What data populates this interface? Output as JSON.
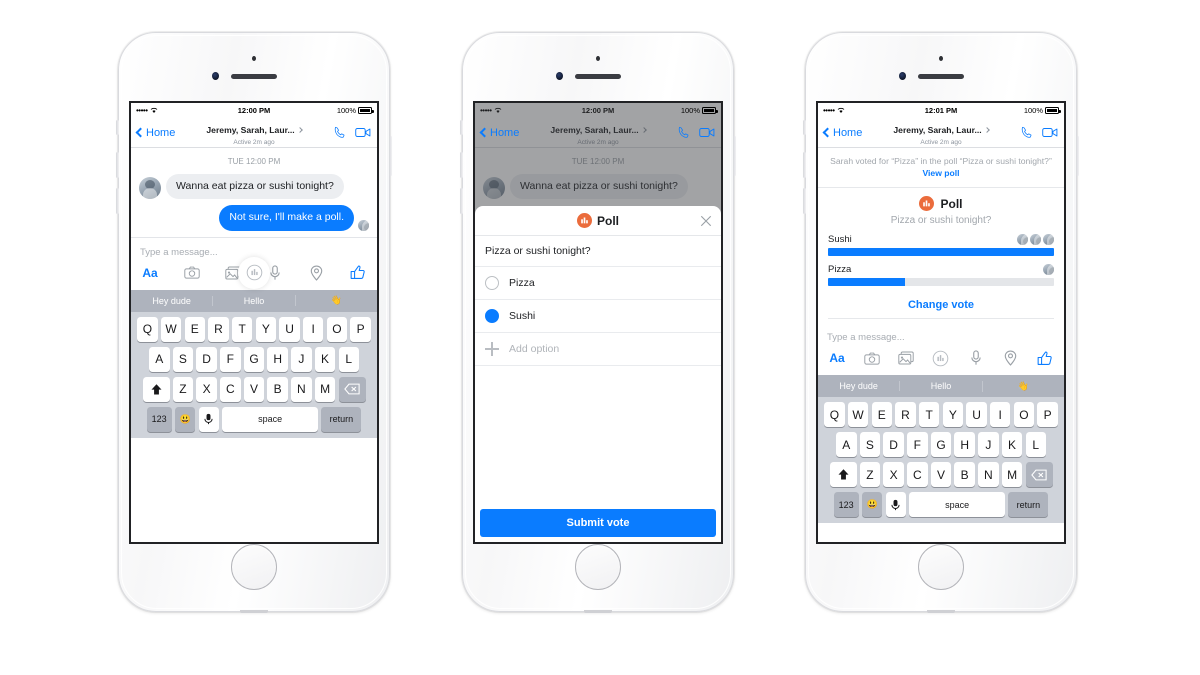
{
  "status_bar": {
    "signal": "•••••",
    "wifi_icon": "wifi-icon",
    "time_1": "12:00 PM",
    "time_2": "12:00 PM",
    "time_3": "12:01 PM",
    "battery": "100%"
  },
  "nav": {
    "back_label": "Home",
    "title": "Jeremy, Sarah, Laur...",
    "subtitle": "Active 2m ago",
    "call_icon": "phone-call-icon",
    "video_icon": "video-call-icon",
    "chevron_icon": "chevron-right-icon"
  },
  "thread": {
    "daystamp": "TUE 12:00 PM",
    "messages": [
      {
        "from": "them",
        "text": "Wanna eat pizza or sushi tonight?"
      },
      {
        "from": "me",
        "text": "Not sure, I'll make a poll."
      }
    ]
  },
  "composer": {
    "placeholder": "Type a message...",
    "icons": [
      "text-format-icon",
      "camera-icon",
      "photos-icon",
      "poll-icon",
      "microphone-icon",
      "location-icon",
      "thumbs-up-icon"
    ]
  },
  "suggestions": [
    "Hey dude",
    "Hello",
    "👋"
  ],
  "keyboard": {
    "row1": [
      "Q",
      "W",
      "E",
      "R",
      "T",
      "Y",
      "U",
      "I",
      "O",
      "P"
    ],
    "row2": [
      "A",
      "S",
      "D",
      "F",
      "G",
      "H",
      "J",
      "K",
      "L"
    ],
    "row3": [
      "Z",
      "X",
      "C",
      "V",
      "B",
      "N",
      "M"
    ],
    "shift": "⬆",
    "backspace": "⌫",
    "numbers": "123",
    "emoji": "😃",
    "dictate": "🎤",
    "space": "space",
    "return": "return"
  },
  "poll_dialog": {
    "title": "Poll",
    "icon": "poll-icon",
    "close_icon": "close-icon",
    "question": "Pizza or sushi tonight?",
    "options": [
      {
        "label": "Pizza",
        "selected": false
      },
      {
        "label": "Sushi",
        "selected": true
      }
    ],
    "add_option": "Add option",
    "add_icon": "plus-icon",
    "submit_label": "Submit vote"
  },
  "poll_result": {
    "notice_text": "Sarah voted for “Pizza” in the poll “Pizza or sushi tonight?” ",
    "notice_link": "View poll",
    "title": "Poll",
    "question": "Pizza or sushi tonight?",
    "change_vote": "Change vote",
    "options": [
      {
        "label": "Sushi",
        "percent": 100,
        "voters": 3
      },
      {
        "label": "Pizza",
        "percent": 34,
        "voters": 1
      }
    ]
  },
  "colors": {
    "accent_blue": "#0a7cff",
    "poll_orange": "#eb6c3c",
    "bubble_gray": "#eceef1",
    "keyboard_bg": "#cfd3da",
    "track_gray": "#e4e6e9"
  },
  "chart_data": {
    "type": "bar",
    "title": "Poll",
    "subtitle": "Pizza or sushi tonight?",
    "categories": [
      "Sushi",
      "Pizza"
    ],
    "values": [
      100,
      34
    ],
    "voter_counts": [
      3,
      1
    ],
    "xlabel": "",
    "ylabel": "",
    "ylim": [
      0,
      100
    ],
    "orientation": "horizontal",
    "grid": false,
    "legend": "none"
  }
}
